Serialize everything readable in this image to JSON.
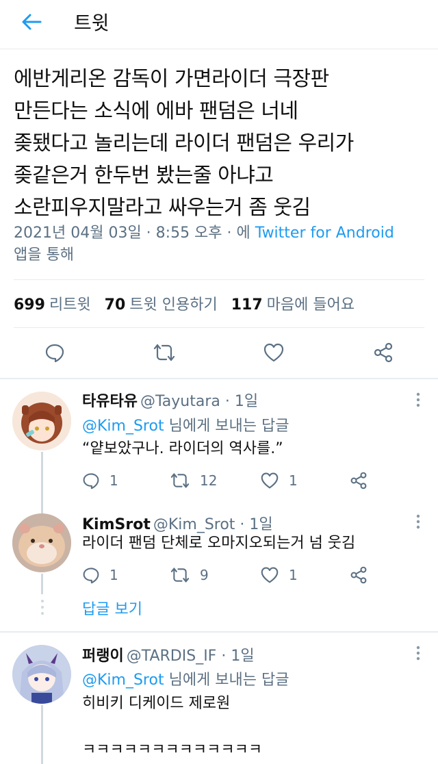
{
  "header": {
    "title": "트윗"
  },
  "tweet": {
    "text": "에반게리온 감독이 가면라이더 극장판\n만든다는 소식에 에바 팬덤은 너네\n좆됐다고 놀리는데 라이더 팬덤은 우리가\n좆같은거 한두번 봤는줄 아냐고\n소란피우지말라고 싸우는거 좀 웃김",
    "date": "2021년 04월 03일 · 8:55 오후 · 에 ",
    "source": "Twitter for Android",
    "source_suffix": "앱을 통해",
    "stats": {
      "retweets_count": "699",
      "retweets_label": "리트윗",
      "quotes_count": "70",
      "quotes_label": "트윗 인용하기",
      "likes_count": "117",
      "likes_label": "마음에 들어요"
    }
  },
  "replies": [
    {
      "name": "타유타유",
      "handle": "@Tayutara · 1일",
      "to_mention": "@Kim_Srot",
      "to_suffix": " 님에게 보내는 답글",
      "body": "“얕보았구나. 라이더의 역사를.”",
      "reply_count": "1",
      "retweet_count": "12",
      "like_count": "1"
    },
    {
      "name": "KimSrot",
      "handle": "@Kim_Srot · 1일",
      "body": "라이더 팬덤 단체로 오마지오되는거 넘 웃김",
      "reply_count": "1",
      "retweet_count": "9",
      "like_count": "1",
      "show_replies": "답글 보기"
    },
    {
      "name": "퍼랭이",
      "handle": "@TARDIS_IF · 1일",
      "to_mention": "@Kim_Srot",
      "to_suffix": " 님에게 보내는 답글",
      "body": "히비키 디케이드 제로원\n\nㅋㅋㅋㅋㅋㅋㅋㅋㅋㅋㅋㅋㅋ"
    }
  ],
  "colors": {
    "accent": "#1d9bf0",
    "muted": "#5b7083",
    "text": "#111111",
    "line": "#cfd9de"
  }
}
